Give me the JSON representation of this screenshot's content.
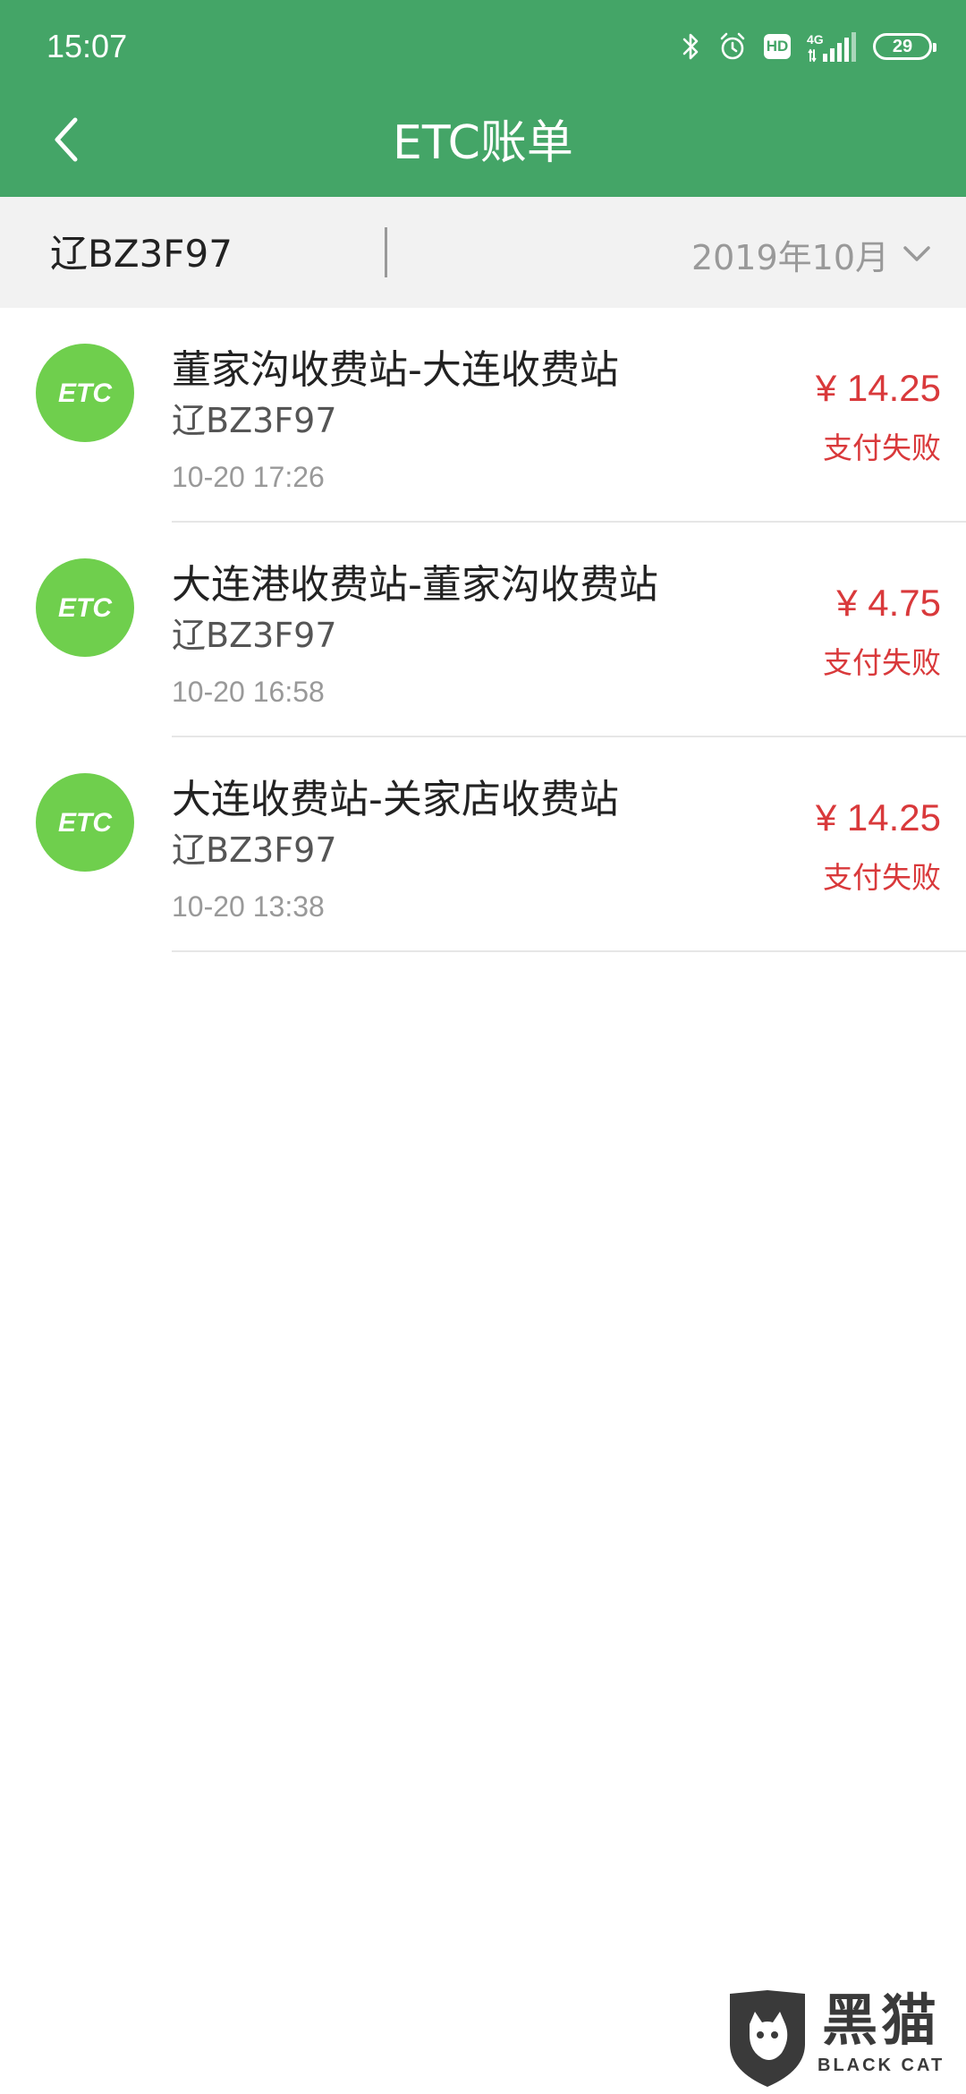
{
  "status_bar": {
    "time": "15:07",
    "network_label": "4G",
    "hd_label": "HD",
    "battery_level": "29",
    "icons": [
      "bluetooth-icon",
      "alarm-icon",
      "hd-icon",
      "signal-icon",
      "battery-icon"
    ]
  },
  "header": {
    "title": "ETC账单",
    "back_icon": "chevron-left-icon"
  },
  "filter": {
    "plate": "辽BZ3F97",
    "month": "2019年10月",
    "dropdown_icon": "chevron-down-icon"
  },
  "bills": [
    {
      "route": "董家沟收费站-大连收费站",
      "plate": "辽BZ3F97",
      "time": "10-20 17:26",
      "amount": "¥ 14.25",
      "status": "支付失败",
      "logo_text": "ETC"
    },
    {
      "route": "大连港收费站-董家沟收费站",
      "plate": "辽BZ3F97",
      "time": "10-20 16:58",
      "amount": "¥ 4.75",
      "status": "支付失败",
      "logo_text": "ETC"
    },
    {
      "route": "大连收费站-关家店收费站",
      "plate": "辽BZ3F97",
      "time": "10-20 13:38",
      "amount": "¥ 14.25",
      "status": "支付失败",
      "logo_text": "ETC"
    }
  ],
  "watermark": {
    "cn": "黑猫",
    "en": "BLACK CAT"
  },
  "colors": {
    "header_bg": "#44a567",
    "etc_green": "#6fcf4d",
    "failure_red": "#d9393b",
    "filter_bg": "#f2f2f2"
  }
}
